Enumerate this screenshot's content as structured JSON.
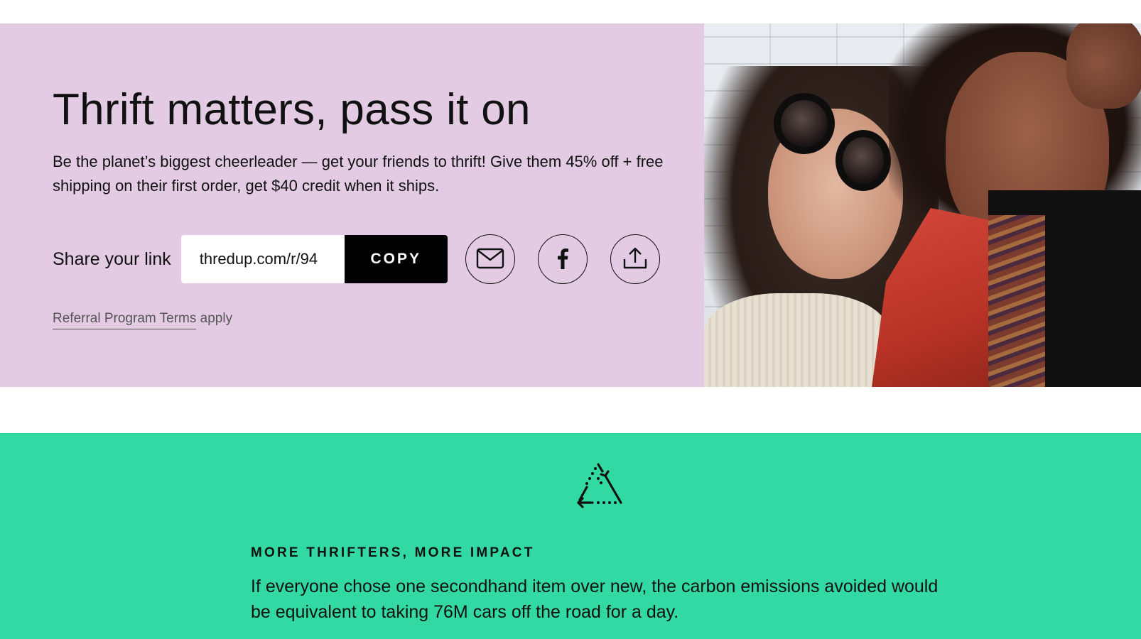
{
  "hero": {
    "title": "Thrift matters, pass it on",
    "description": "Be the planet’s biggest cheerleader — get your friends to thrift! Give them 45% off + free shipping on their first order, get $40 credit when it ships.",
    "share_label": "Share your link",
    "link_value": "thredup.com/r/94",
    "copy_label": "COPY",
    "terms_link": "Referral Program Terms",
    "terms_suffix": " apply",
    "share_icons": [
      "mail-icon",
      "facebook-icon",
      "share-upload-icon"
    ]
  },
  "impact": {
    "eyebrow": "MORE THRIFTERS, MORE IMPACT",
    "text": "If everyone chose one secondhand item over new, the carbon emissions avoided would be equivalent to taking 76M cars off the road for a day."
  },
  "colors": {
    "hero_bg": "#e3cbe4",
    "impact_bg": "#33d9a3",
    "button_bg": "#000000"
  }
}
